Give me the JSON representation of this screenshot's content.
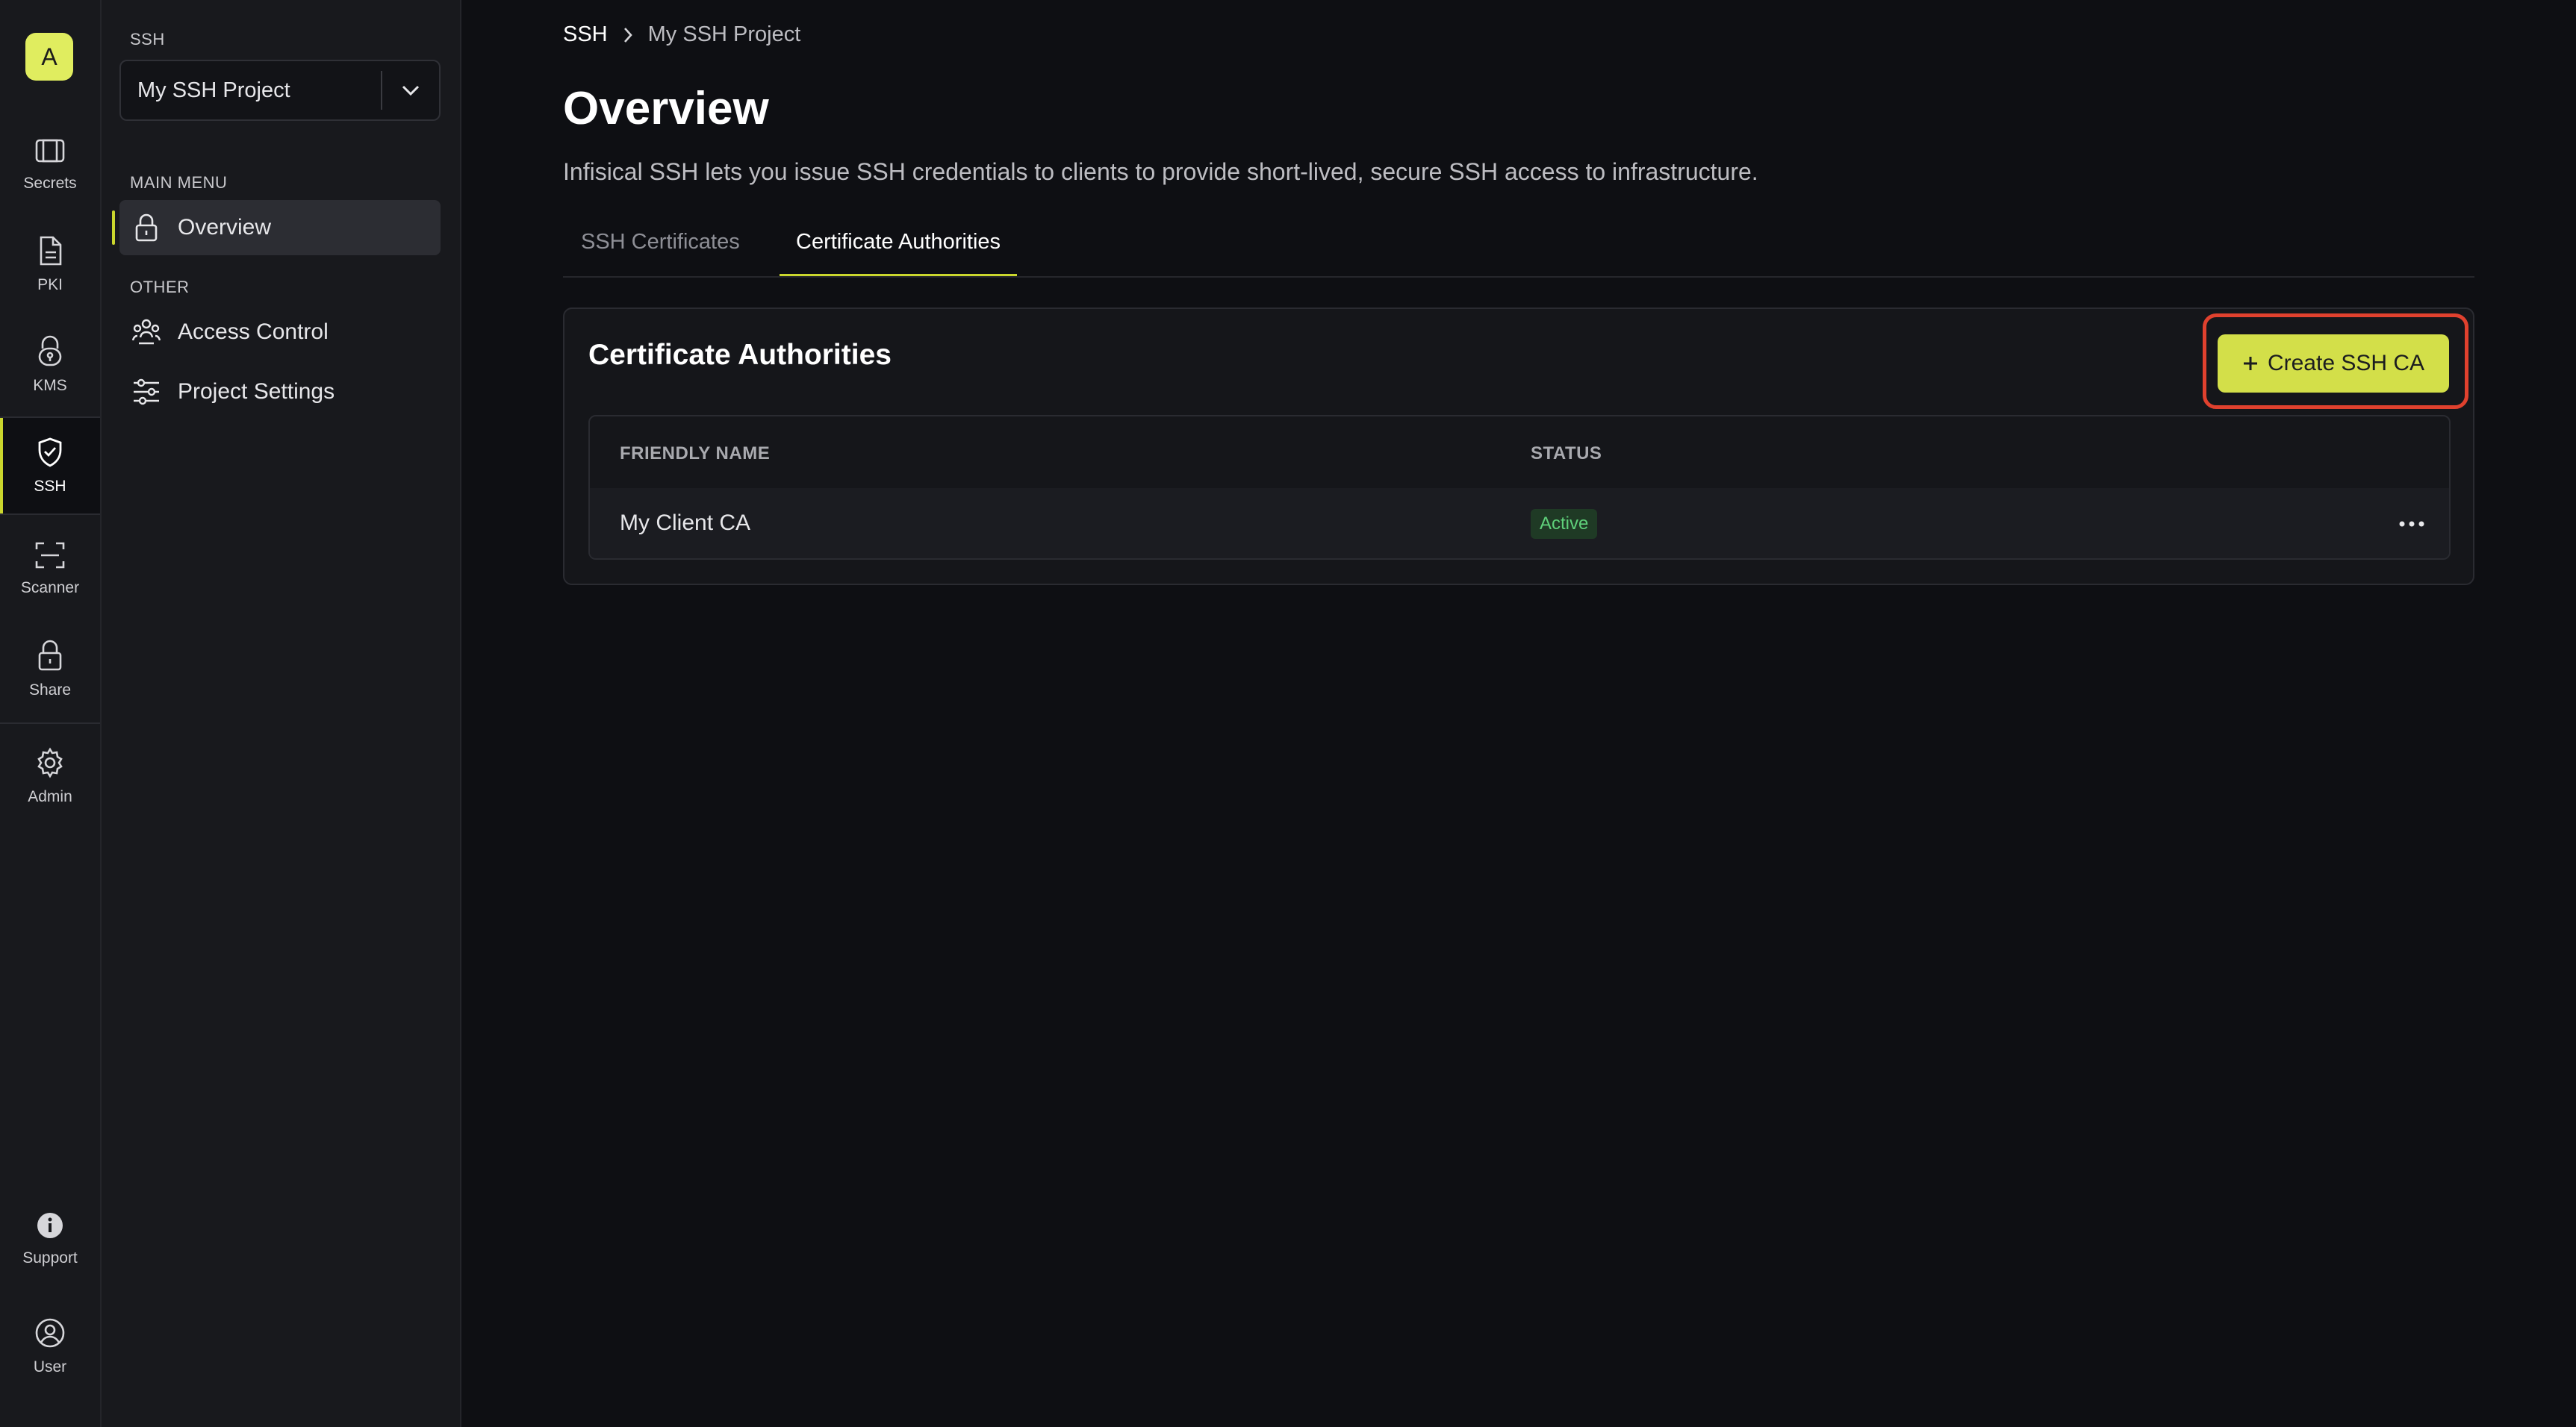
{
  "org_avatar": "A",
  "rail": {
    "items": [
      {
        "label": "Secrets",
        "icon": "vault-icon"
      },
      {
        "label": "PKI",
        "icon": "document-icon"
      },
      {
        "label": "KMS",
        "icon": "lock-key-icon"
      },
      {
        "label": "SSH",
        "icon": "shield-check-icon"
      },
      {
        "label": "Scanner",
        "icon": "scan-icon"
      },
      {
        "label": "Share",
        "icon": "lock-icon"
      },
      {
        "label": "Admin",
        "icon": "gear-icon"
      },
      {
        "label": "Support",
        "icon": "info-icon"
      },
      {
        "label": "User",
        "icon": "user-circle-icon"
      }
    ],
    "active": "SSH"
  },
  "sidebar": {
    "section_label": "SSH",
    "project_name": "My SSH Project",
    "main_menu_label": "MAIN MENU",
    "other_label": "OTHER",
    "main_items": [
      {
        "label": "Overview",
        "icon": "lock-icon"
      }
    ],
    "other_items": [
      {
        "label": "Access Control",
        "icon": "users-icon"
      },
      {
        "label": "Project Settings",
        "icon": "sliders-icon"
      }
    ]
  },
  "breadcrumb": {
    "root": "SSH",
    "current": "My SSH Project"
  },
  "page": {
    "title": "Overview",
    "subtitle": "Infisical SSH lets you issue SSH credentials to clients to provide short-lived, secure SSH access to infrastructure."
  },
  "tabs": [
    {
      "label": "SSH Certificates",
      "active": false
    },
    {
      "label": "Certificate Authorities",
      "active": true
    }
  ],
  "panel": {
    "title": "Certificate Authorities",
    "create_button": "Create SSH CA",
    "table": {
      "columns": [
        "FRIENDLY NAME",
        "STATUS"
      ],
      "rows": [
        {
          "name": "My Client CA",
          "status": "Active"
        }
      ]
    }
  },
  "colors": {
    "accent": "#cad62d",
    "button": "#d3df49",
    "highlight": "#e0412e",
    "status_active": "#5fd07a"
  }
}
